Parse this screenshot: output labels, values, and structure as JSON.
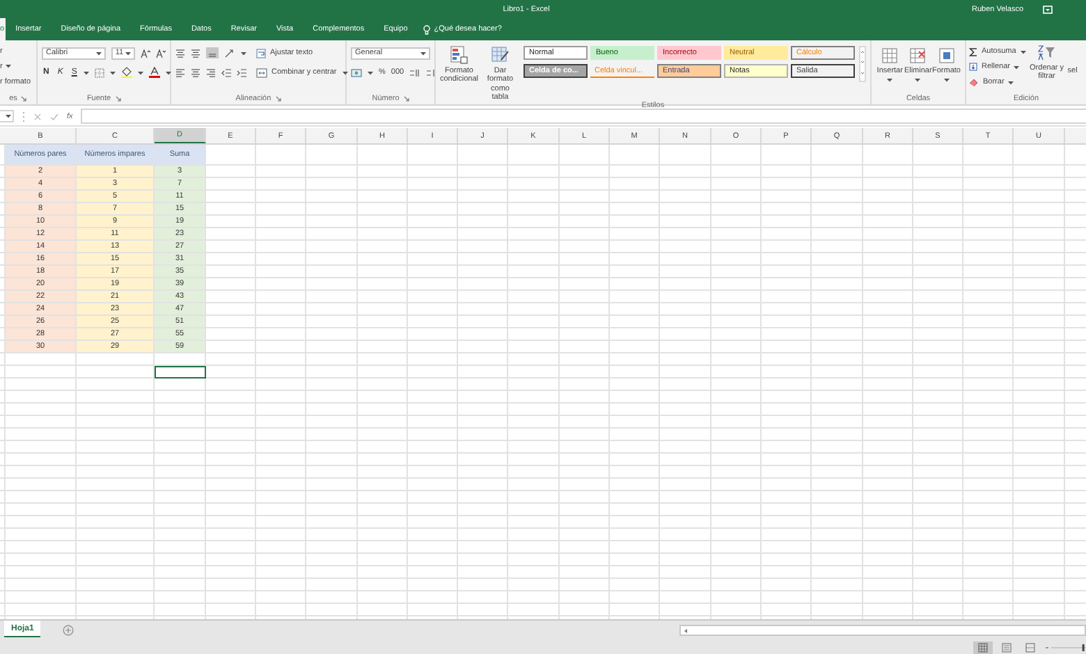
{
  "title_bar": {
    "title": "Libro1 - Excel",
    "user": "Ruben Velasco"
  },
  "ribbon_tabs": [
    {
      "label": "o",
      "selected": true
    },
    {
      "label": "Insertar",
      "selected": false
    },
    {
      "label": "Diseño de página",
      "selected": false
    },
    {
      "label": "Fórmulas",
      "selected": false
    },
    {
      "label": "Datos",
      "selected": false
    },
    {
      "label": "Revisar",
      "selected": false
    },
    {
      "label": "Vista",
      "selected": false
    },
    {
      "label": "Complementos",
      "selected": false
    },
    {
      "label": "Equipo",
      "selected": false
    }
  ],
  "tell_me": "¿Qué desea hacer?",
  "ribbon": {
    "clipboard": {
      "labels": [
        "r",
        "r",
        "r formato"
      ],
      "group_label": "es"
    },
    "font": {
      "font_name": "Calibri",
      "font_size": "11",
      "bold": "N",
      "italic": "K",
      "underline": "S",
      "group_label": "Fuente"
    },
    "alignment": {
      "wrap_text": "Ajustar texto",
      "merge_center": "Combinar y centrar",
      "group_label": "Alineación"
    },
    "number": {
      "format": "General",
      "percent": "%",
      "thousands": "000",
      "group_label": "Número"
    },
    "styles": {
      "conditional_format": "Formato condicional",
      "format_as_table": "Dar formato como tabla",
      "group_label": "Estilos",
      "cell_styles": [
        {
          "label": "Normal",
          "kind": "normal"
        },
        {
          "label": "Bueno",
          "kind": "good"
        },
        {
          "label": "Incorrecto",
          "kind": "bad"
        },
        {
          "label": "Neutral",
          "kind": "neutral"
        },
        {
          "label": "Cálculo",
          "kind": "calc"
        },
        {
          "label": "Celda de co...",
          "kind": "check"
        },
        {
          "label": "Celda vincul...",
          "kind": "linked"
        },
        {
          "label": "Entrada",
          "kind": "input"
        },
        {
          "label": "Notas",
          "kind": "note"
        },
        {
          "label": "Salida",
          "kind": "output"
        }
      ]
    },
    "cells": {
      "buttons": [
        "Insertar",
        "Eliminar",
        "Formato"
      ],
      "group_label": "Celdas"
    },
    "editing": {
      "autosum": "Autosuma",
      "fill": "Rellenar",
      "clear": "Borrar",
      "sort_filter": "Ordenar y filtrar",
      "find_select": "sel",
      "group_label": "Edición"
    }
  },
  "formula_bar": {
    "function_symbol": "fx"
  },
  "column_headers": [
    {
      "label": "B",
      "selected": false
    },
    {
      "label": "C",
      "selected": false
    },
    {
      "label": "D",
      "selected": true
    },
    {
      "label": "E",
      "selected": false
    },
    {
      "label": "F",
      "selected": false
    },
    {
      "label": "G",
      "selected": false
    },
    {
      "label": "H",
      "selected": false
    },
    {
      "label": "I",
      "selected": false
    },
    {
      "label": "J",
      "selected": false
    },
    {
      "label": "K",
      "selected": false
    },
    {
      "label": "L",
      "selected": false
    },
    {
      "label": "M",
      "selected": false
    },
    {
      "label": "N",
      "selected": false
    },
    {
      "label": "O",
      "selected": false
    },
    {
      "label": "P",
      "selected": false
    },
    {
      "label": "Q",
      "selected": false
    },
    {
      "label": "R",
      "selected": false
    },
    {
      "label": "S",
      "selected": false
    },
    {
      "label": "T",
      "selected": false
    },
    {
      "label": "U",
      "selected": false
    }
  ],
  "table": {
    "columns": [
      {
        "header": "Números pares",
        "color": "#fce4d6"
      },
      {
        "header": "Números impares",
        "color": "#fff2cc"
      },
      {
        "header": "Suma",
        "color": "#e2efda"
      }
    ],
    "rows": [
      [
        "2",
        "1",
        "3"
      ],
      [
        "4",
        "3",
        "7"
      ],
      [
        "6",
        "5",
        "11"
      ],
      [
        "8",
        "7",
        "15"
      ],
      [
        "10",
        "9",
        "19"
      ],
      [
        "12",
        "11",
        "23"
      ],
      [
        "14",
        "13",
        "27"
      ],
      [
        "16",
        "15",
        "31"
      ],
      [
        "18",
        "17",
        "35"
      ],
      [
        "20",
        "19",
        "39"
      ],
      [
        "22",
        "21",
        "43"
      ],
      [
        "24",
        "23",
        "47"
      ],
      [
        "26",
        "25",
        "51"
      ],
      [
        "28",
        "27",
        "55"
      ],
      [
        "30",
        "29",
        "59"
      ]
    ]
  },
  "rows_below": [
    [
      {
        "selected": false
      },
      {
        "selected": false
      },
      {
        "selected": false
      }
    ],
    [
      {
        "selected": false
      },
      {
        "selected": false
      },
      {
        "selected": true
      }
    ]
  ],
  "sheet_tabs": [
    {
      "label": "Hoja1",
      "selected": true
    }
  ],
  "zoom_slider": {
    "level": 0.95
  }
}
